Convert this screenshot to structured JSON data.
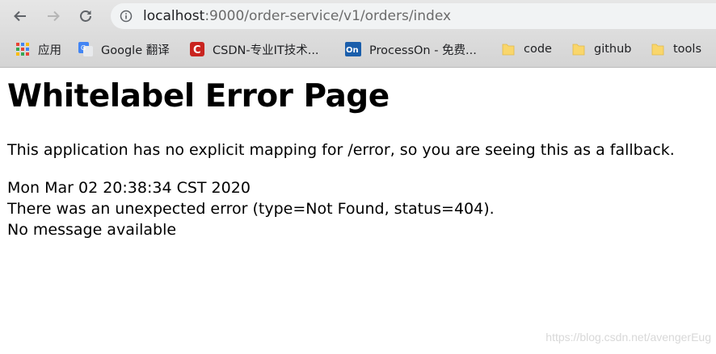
{
  "browser": {
    "url_host": "localhost",
    "url_rest": ":9000/order-service/v1/orders/index",
    "bookmarks": [
      {
        "label": "应用",
        "icon": "apps-grid-icon"
      },
      {
        "label": "Google 翻译",
        "icon": "google-translate-icon"
      },
      {
        "label": "CSDN-专业IT技术...",
        "icon": "csdn-logo-icon"
      },
      {
        "label": "ProcessOn - 免费...",
        "icon": "processon-logo-icon"
      },
      {
        "label": "code",
        "icon": "folder-icon"
      },
      {
        "label": "github",
        "icon": "folder-icon"
      },
      {
        "label": "tools",
        "icon": "folder-icon"
      }
    ]
  },
  "page": {
    "title": "Whitelabel Error Page",
    "explanation": "This application has no explicit mapping for /error, so you are seeing this as a fallback.",
    "timestamp": "Mon Mar 02 20:38:34 CST 2020",
    "error_line": "There was an unexpected error (type=Not Found, status=404).",
    "message": "No message available"
  },
  "watermark": "https://blog.csdn.net/avengerEug",
  "colors": {
    "csdn_red": "#c9241f",
    "processon_blue": "#1a5eab",
    "folder_yellow": "#f9d66b"
  }
}
